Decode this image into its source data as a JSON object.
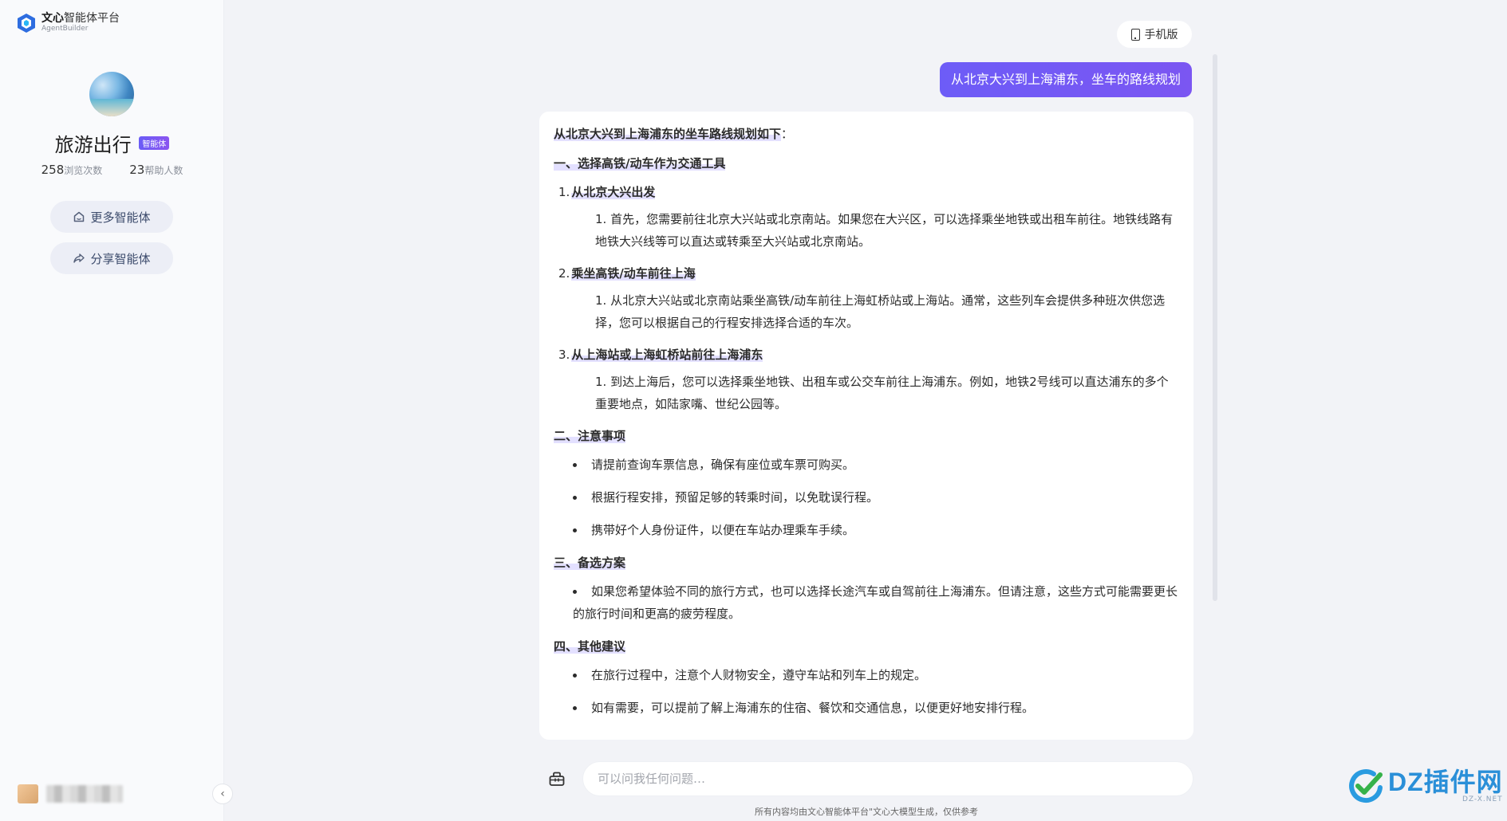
{
  "logo": {
    "brand": "文心",
    "name": "智能体平台",
    "sub": "AgentBuilder"
  },
  "agent": {
    "title": "旅游出行",
    "badge": "智能体",
    "views_count": "258",
    "views_label": "浏览次数",
    "helped_count": "23",
    "helped_label": "帮助人数"
  },
  "sidebar": {
    "more_label": "更多智能体",
    "share_label": "分享智能体"
  },
  "header": {
    "mobile_label": "手机版"
  },
  "conversation": {
    "user_message": "从北京大兴到上海浦东，坐车的路线规划",
    "answer": {
      "intro": "从北京大兴到上海浦东的坐车路线规划如下",
      "intro_tail": "：",
      "section1_title": "一、选择高铁/动车作为交通工具",
      "steps": [
        {
          "num": "1.",
          "title": "从北京大兴出发",
          "detail": "1. 首先，您需要前往北京大兴站或北京南站。如果您在大兴区，可以选择乘坐地铁或出租车前往。地铁线路有地铁大兴线等可以直达或转乘至大兴站或北京南站。"
        },
        {
          "num": "2.",
          "title": "乘坐高铁/动车前往上海",
          "detail": "1. 从北京大兴站或北京南站乘坐高铁/动车前往上海虹桥站或上海站。通常，这些列车会提供多种班次供您选择，您可以根据自己的行程安排选择合适的车次。"
        },
        {
          "num": "3.",
          "title": "从上海站或上海虹桥站前往上海浦东",
          "detail": "1. 到达上海后，您可以选择乘坐地铁、出租车或公交车前往上海浦东。例如，地铁2号线可以直达浦东的多个重要地点，如陆家嘴、世纪公园等。"
        }
      ],
      "section2_title": "二、注意事项",
      "notes": [
        "请提前查询车票信息，确保有座位或车票可购买。",
        "根据行程安排，预留足够的转乘时间，以免耽误行程。",
        "携带好个人身份证件，以便在车站办理乘车手续。"
      ],
      "section3_title": "三、备选方案",
      "alternatives": [
        "如果您希望体验不同的旅行方式，也可以选择长途汽车或自驾前往上海浦东。但请注意，这些方式可能需要更长的旅行时间和更高的疲劳程度。"
      ],
      "section4_title": "四、其他建议",
      "suggestions": [
        "在旅行过程中，注意个人财物安全，遵守车站和列车上的规定。",
        "如有需要，可以提前了解上海浦东的住宿、餐饮和交通信息，以便更好地安排行程。"
      ]
    }
  },
  "input": {
    "placeholder": "可以问我任何问题…"
  },
  "footer": {
    "disclaimer": "所有内容均由文心智能体平台\"文心大模型生成，仅供参考"
  },
  "watermark": {
    "text": "DZ插件网",
    "sub": "DZ-X.NET"
  },
  "colors": {
    "accent": "#6d5cf7",
    "sidebar_bg": "#f9fafc",
    "page_bg": "#f2f3f7",
    "highlight": "#e3e0ff"
  }
}
